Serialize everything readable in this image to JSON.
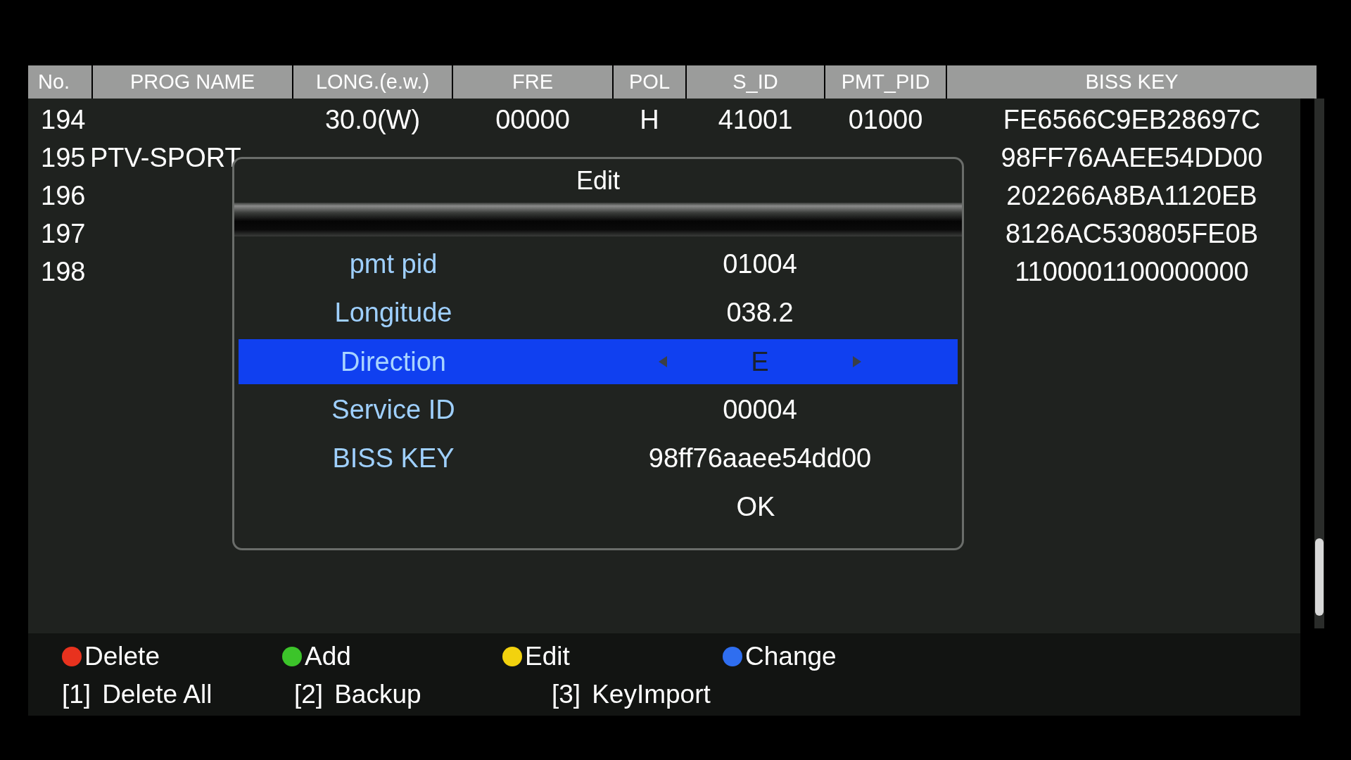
{
  "table": {
    "columns": [
      "No.",
      "PROG NAME",
      "LONG.(e.w.)",
      "FRE",
      "POL",
      "S_ID",
      "PMT_PID",
      "BISS KEY"
    ],
    "rows": [
      {
        "no": "194",
        "long": "30.0(W)",
        "fre": "00000",
        "pol": "H",
        "sid": "41001",
        "pmt": "01000",
        "key": "FE6566C9EB28697C"
      },
      {
        "no": "195",
        "name": "PTV-SPORT",
        "key": "98FF76AAEE54DD00"
      },
      {
        "no": "196",
        "key": "202266A8BA1120EB"
      },
      {
        "no": "197",
        "key": "8126AC530805FE0B"
      },
      {
        "no": "198",
        "key": "1100001100000000"
      }
    ]
  },
  "dialog": {
    "title": "Edit",
    "fields": [
      {
        "label": "pmt pid",
        "value": "01004",
        "kind": "text",
        "selected": false
      },
      {
        "label": "Longitude",
        "value": "038.2",
        "kind": "text",
        "selected": false
      },
      {
        "label": "Direction",
        "value": "E",
        "kind": "choice",
        "selected": true
      },
      {
        "label": "Service ID",
        "value": "00004",
        "kind": "text",
        "selected": false
      },
      {
        "label": "BISS KEY",
        "value": "98ff76aaee54dd00",
        "kind": "text",
        "selected": false
      }
    ],
    "ok": "OK"
  },
  "footer": {
    "color_keys": [
      {
        "label": "Delete",
        "color": "#e8321e"
      },
      {
        "label": "Add",
        "color": "#3cc42a"
      },
      {
        "label": "Edit",
        "color": "#f2d20e"
      },
      {
        "label": "Change",
        "color": "#2f6ef0"
      }
    ],
    "number_keys": [
      {
        "key": "[1]",
        "label": "Delete All"
      },
      {
        "key": "[2]",
        "label": "Backup"
      },
      {
        "key": "[3]",
        "label": "KeyImport"
      }
    ]
  }
}
